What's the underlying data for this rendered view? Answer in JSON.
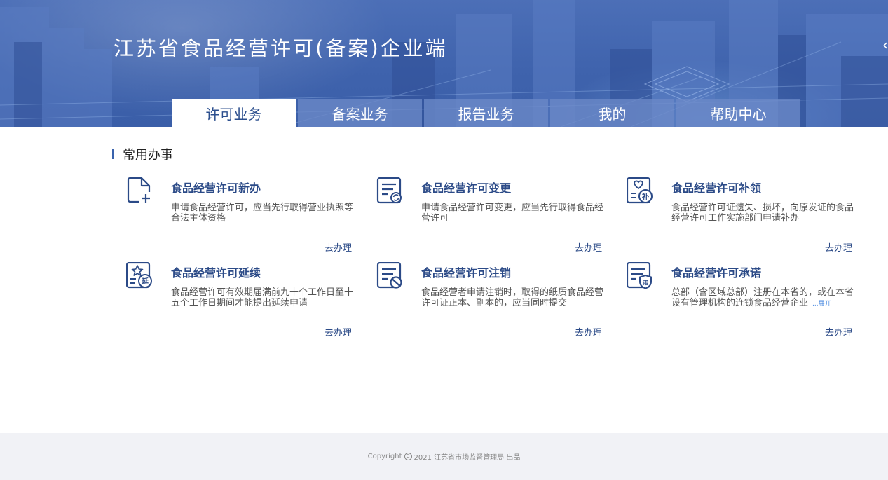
{
  "header": {
    "title": "江苏省食品经营许可(备案)企业端"
  },
  "tabs": [
    {
      "label": "许可业务",
      "active": true
    },
    {
      "label": "备案业务",
      "active": false
    },
    {
      "label": "报告业务",
      "active": false
    },
    {
      "label": "我的",
      "active": false
    },
    {
      "label": "帮助中心",
      "active": false
    }
  ],
  "section": {
    "title": "常用办事"
  },
  "cards": [
    {
      "title": "食品经营许可新办",
      "desc": "申请食品经营许可，应当先行取得营业执照等合法主体资格",
      "action": "去办理",
      "icon": "file-add-icon"
    },
    {
      "title": "食品经营许可变更",
      "desc": "申请食品经营许可变更，应当先行取得食品经营许可",
      "action": "去办理",
      "icon": "document-refresh-icon"
    },
    {
      "title": "食品经营许可补领",
      "desc": "食品经营许可证遗失、损坏，向原发证的食品经营许可工作实施部门申请补办",
      "action": "去办理",
      "icon": "heart-document-bu-icon"
    },
    {
      "title": "食品经营许可延续",
      "desc": "食品经营许可有效期届满前九十个工作日至十五个工作日期间才能提出延续申请",
      "action": "去办理",
      "icon": "star-document-yan-icon"
    },
    {
      "title": "食品经营许可注销",
      "desc": "食品经营者申请注销时，取得的纸质食品经营许可证正本、副本的，应当同时提交",
      "action": "去办理",
      "icon": "document-cancel-icon"
    },
    {
      "title": "食品经营许可承诺",
      "desc": "总部（含区域总部）注册在本省的，或在本省设有管理机构的连锁食品经营企业",
      "more": "...展开",
      "action": "去办理",
      "icon": "document-shield-icon"
    }
  ],
  "footer": {
    "prefix": "Copyright",
    "symbol": "C",
    "text": "2021 江苏省市场监督管理局 出品"
  },
  "colors": {
    "brand": "#2b4a87",
    "banner": "#3f63ad",
    "accent_link": "#4a8ae0"
  }
}
